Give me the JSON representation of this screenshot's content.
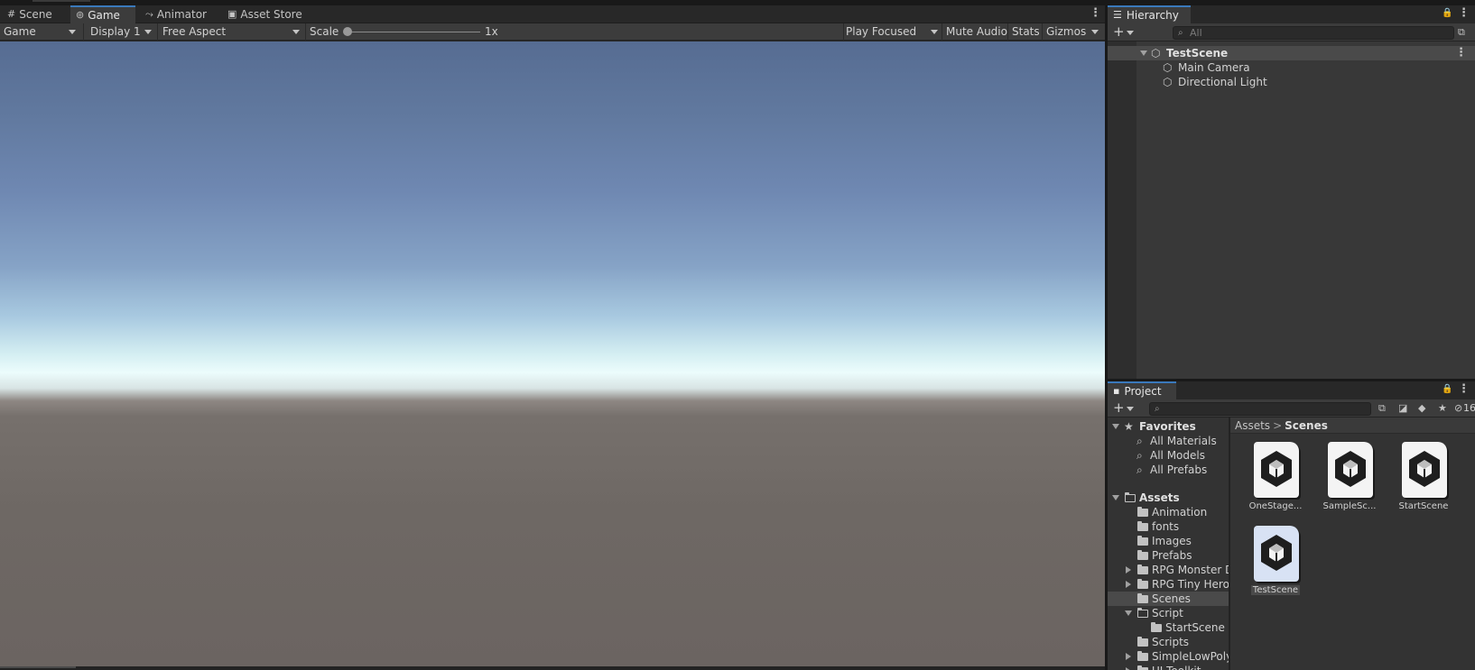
{
  "game_view": {
    "tabs": [
      {
        "label": "Scene",
        "icon": "#"
      },
      {
        "label": "Game",
        "icon": "⊚"
      },
      {
        "label": "Animator",
        "icon": "⤳"
      },
      {
        "label": "Asset Store",
        "icon": "▣"
      }
    ],
    "menu_icon": "⋮",
    "toolbar": {
      "mode": "Game",
      "display": "Display 1",
      "aspect": "Free Aspect",
      "scale_label": "Scale",
      "scale_value": "1x",
      "scale_fraction": 0.0,
      "play_mode": "Play Focused",
      "mute": "Mute Audio",
      "stats": "Stats",
      "gizmos": "Gizmos"
    }
  },
  "hierarchy": {
    "title": "Hierarchy",
    "icon": "☰",
    "plus": "+",
    "search_placeholder": "All",
    "search_icon": "⌕",
    "search_end_icon": "⧉",
    "lock_icon": "🔒",
    "menu_icon": "⋮",
    "scene": {
      "name": "TestScene",
      "icon": "⬡"
    },
    "objects": [
      {
        "name": "Main Camera",
        "icon": "⬡"
      },
      {
        "name": "Directional Light",
        "icon": "⬡"
      }
    ]
  },
  "project": {
    "title": "Project",
    "icon": "▪",
    "plus": "+",
    "search_icon": "⌕",
    "lock_icon": "🔒",
    "menu_icon": "⋮",
    "toolbar_icons": {
      "scene_search": "⧉",
      "filter": "◪",
      "label": "◆",
      "star": "★",
      "hidden": "⊘"
    },
    "hidden_count": "16",
    "favorites": {
      "label": "Favorites",
      "icon": "★",
      "search_icon": "⌕",
      "items": [
        "All Materials",
        "All Models",
        "All Prefabs"
      ]
    },
    "assets_tree": {
      "label": "Assets",
      "items": [
        {
          "name": "Animation",
          "depth": 1,
          "expander": ""
        },
        {
          "name": "fonts",
          "depth": 1,
          "expander": ""
        },
        {
          "name": "Images",
          "depth": 1,
          "expander": ""
        },
        {
          "name": "Prefabs",
          "depth": 1,
          "expander": ""
        },
        {
          "name": "RPG Monster D",
          "depth": 1,
          "expander": "right"
        },
        {
          "name": "RPG Tiny Hero",
          "depth": 1,
          "expander": "right"
        },
        {
          "name": "Scenes",
          "depth": 1,
          "expander": "",
          "selected": true
        },
        {
          "name": "Script",
          "depth": 1,
          "expander": "down",
          "open": true
        },
        {
          "name": "StartScene",
          "depth": 2,
          "expander": ""
        },
        {
          "name": "Scripts",
          "depth": 1,
          "expander": ""
        },
        {
          "name": "SimpleLowPoly",
          "depth": 1,
          "expander": "right"
        },
        {
          "name": "UI Toolkit",
          "depth": 1,
          "expander": "right"
        }
      ]
    },
    "breadcrumb": {
      "root": "Assets",
      "sep": ">",
      "current": "Scenes"
    },
    "scene_files": [
      {
        "label": "OneStage...",
        "selected": false
      },
      {
        "label": "SampleSc...",
        "selected": false
      },
      {
        "label": "StartScene",
        "selected": false
      },
      {
        "label": "TestScene",
        "selected": true
      }
    ]
  }
}
